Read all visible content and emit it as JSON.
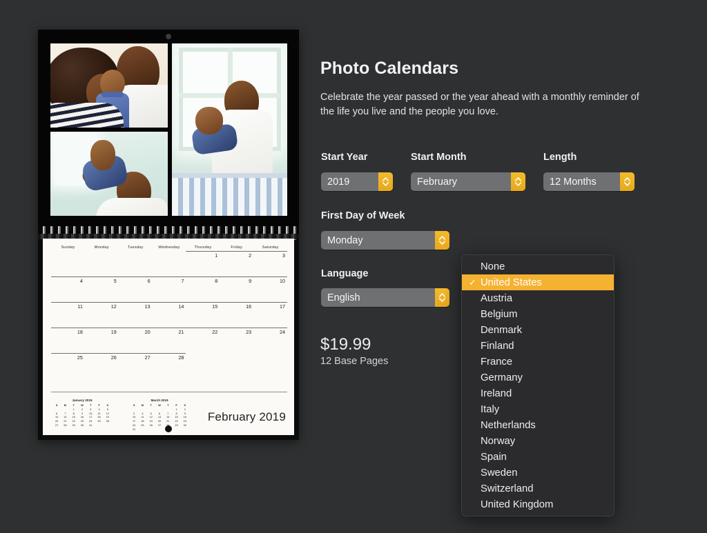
{
  "theme": {
    "page_bg": "#2e3032",
    "accent": "#f5b231",
    "control_bg": "#6f7072",
    "menu_bg": "#2b2b2d"
  },
  "product": {
    "title": "Photo Calendars",
    "description": "Celebrate the year passed or the year ahead with a monthly reminder of the life you live and the people you love.",
    "price": "$19.99",
    "pages": "12 Base Pages"
  },
  "options": {
    "start_year": {
      "label": "Start Year",
      "value": "2019"
    },
    "start_month": {
      "label": "Start Month",
      "value": "February"
    },
    "length": {
      "label": "Length",
      "value": "12 Months"
    },
    "first_day_of_week": {
      "label": "First Day of Week",
      "value": "Monday"
    },
    "language": {
      "label": "Language",
      "value": "English"
    }
  },
  "holidays_menu": {
    "selected": "United States",
    "check_glyph": "✓",
    "items": [
      "None",
      "United States",
      "Austria",
      "Belgium",
      "Denmark",
      "Finland",
      "France",
      "Germany",
      "Ireland",
      "Italy",
      "Netherlands",
      "Norway",
      "Spain",
      "Sweden",
      "Switzerland",
      "United Kingdom"
    ]
  },
  "preview": {
    "month_label": "February 2019",
    "day_names": [
      "Sunday",
      "Monday",
      "Tuesday",
      "Wednesday",
      "Thursday",
      "Friday",
      "Saturday"
    ],
    "weeks": [
      [
        "",
        "",
        "",
        "",
        "1",
        "2",
        "3"
      ],
      [
        "4",
        "5",
        "6",
        "7",
        "8",
        "9",
        "10"
      ],
      [
        "11",
        "12",
        "13",
        "14",
        "15",
        "16",
        "17"
      ],
      [
        "18",
        "19",
        "20",
        "21",
        "22",
        "23",
        "24"
      ],
      [
        "25",
        "26",
        "27",
        "28",
        "",
        "",
        ""
      ]
    ],
    "mini_calendars": [
      {
        "title": "January 2019",
        "dow": [
          "S",
          "M",
          "T",
          "W",
          "T",
          "F",
          "S"
        ],
        "weeks": [
          [
            "",
            "",
            "1",
            "2",
            "3",
            "4",
            "5"
          ],
          [
            "6",
            "7",
            "8",
            "9",
            "10",
            "11",
            "12"
          ],
          [
            "13",
            "14",
            "15",
            "16",
            "17",
            "18",
            "19"
          ],
          [
            "20",
            "21",
            "22",
            "23",
            "24",
            "25",
            "26"
          ],
          [
            "27",
            "28",
            "29",
            "30",
            "31",
            "",
            ""
          ]
        ]
      },
      {
        "title": "March 2019",
        "dow": [
          "S",
          "M",
          "T",
          "W",
          "T",
          "F",
          "S"
        ],
        "weeks": [
          [
            "",
            "",
            "",
            "",
            "",
            "1",
            "2"
          ],
          [
            "3",
            "4",
            "5",
            "6",
            "7",
            "8",
            "9"
          ],
          [
            "10",
            "11",
            "12",
            "13",
            "14",
            "15",
            "16"
          ],
          [
            "17",
            "18",
            "19",
            "20",
            "21",
            "22",
            "23"
          ],
          [
            "24",
            "25",
            "26",
            "27",
            "28",
            "29",
            "30"
          ],
          [
            "31",
            "",
            "",
            "",
            "",
            "",
            ""
          ]
        ]
      }
    ]
  }
}
